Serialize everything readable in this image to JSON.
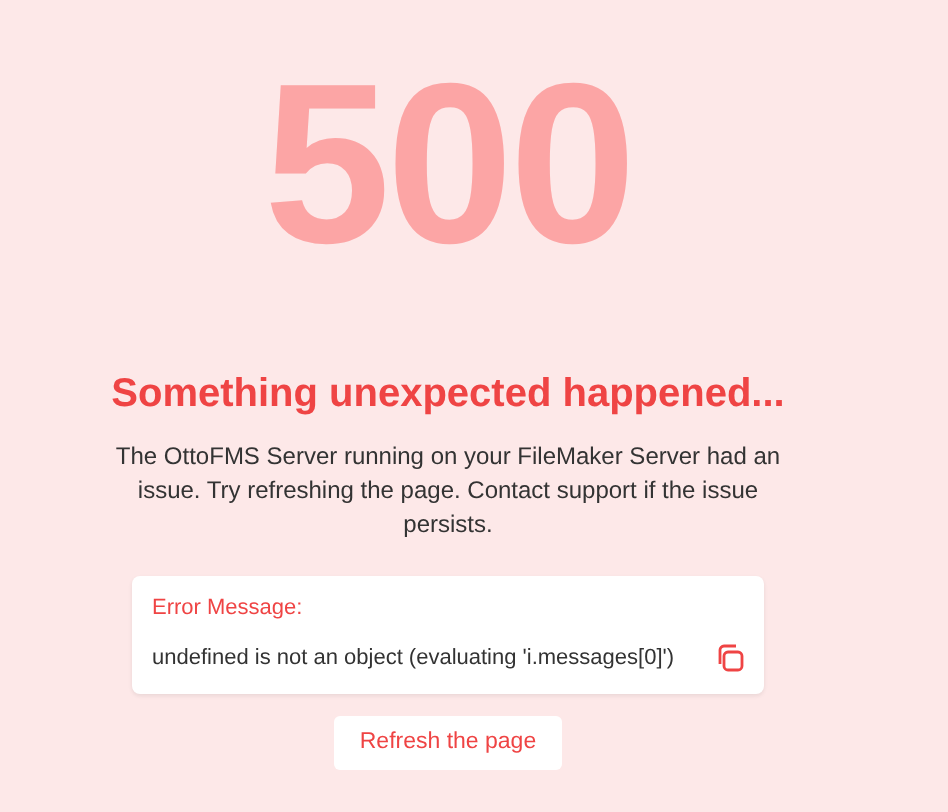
{
  "code": "500",
  "title": "Something unexpected happened...",
  "message": "The OttoFMS Server running on your FileMaker Server had an issue. Try refreshing the page. Contact support if the issue persists.",
  "error": {
    "label": "Error Message:",
    "text": "undefined is not an object (evaluating 'i.messages[0]')"
  },
  "button": "Refresh the page"
}
